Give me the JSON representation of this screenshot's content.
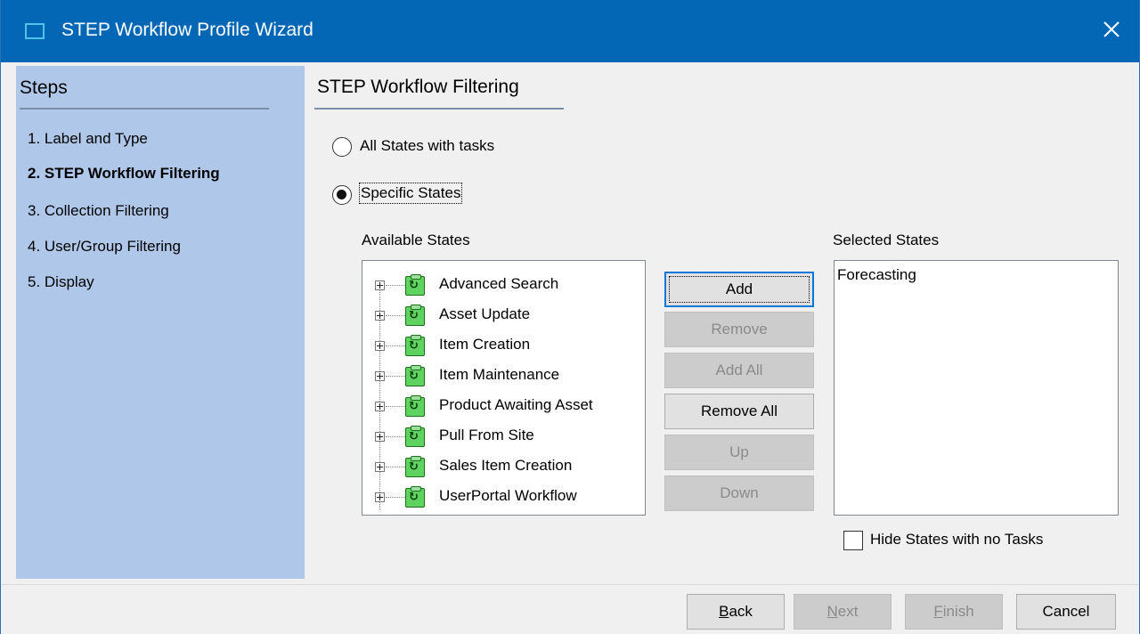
{
  "window": {
    "title": "STEP Workflow Profile Wizard",
    "close_icon": "close-icon"
  },
  "sidebar": {
    "title": "Steps",
    "items": [
      {
        "label": "1. Label and Type",
        "active": false
      },
      {
        "label": "2. STEP Workflow Filtering",
        "active": true
      },
      {
        "label": "3. Collection Filtering",
        "active": false
      },
      {
        "label": "4. User/Group Filtering",
        "active": false
      },
      {
        "label": "5. Display",
        "active": false
      }
    ]
  },
  "main": {
    "title": "STEP Workflow Filtering",
    "options": [
      {
        "label": "All States with tasks",
        "selected": false
      },
      {
        "label": "Specific States",
        "selected": true
      }
    ],
    "available_label": "Available States",
    "available_states": [
      "Advanced Search",
      "Asset Update",
      "Item Creation",
      "Item Maintenance",
      "Product Awaiting Asset",
      "Pull From Site",
      "Sales Item Creation",
      "UserPortal Workflow"
    ],
    "selected_label": "Selected States",
    "selected_states": [
      "Forecasting"
    ],
    "buttons": {
      "add": "Add",
      "remove": "Remove",
      "add_all": "Add All",
      "remove_all": "Remove All",
      "up": "Up",
      "down": "Down"
    },
    "hide_checkbox_label": "Hide States with no Tasks",
    "hide_checked": false
  },
  "footer": {
    "back_mnemonic": "B",
    "back_rest": "ack",
    "next_mnemonic": "N",
    "next_rest": "ext",
    "finish_mnemonic": "F",
    "finish_rest": "inish",
    "cancel": "Cancel"
  },
  "colors": {
    "titlebar": "#0467b5",
    "sidebar": "#afc8ea",
    "workflow_icon": "#5fd35f"
  }
}
